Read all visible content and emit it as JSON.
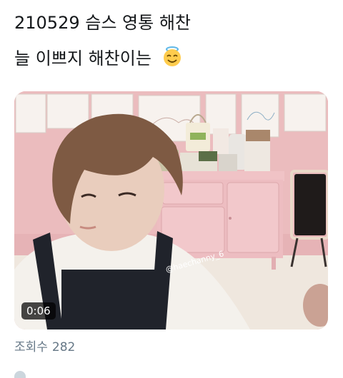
{
  "tweet": {
    "line1": "210529 슴스 영통 해찬",
    "line2": "늘 이쁘지 해찬이는",
    "emoji": "smiling-face-with-halo-icon"
  },
  "video": {
    "timestamp": "0:06",
    "watermark": "@haechanny_6"
  },
  "stats": {
    "views_label": "조회수",
    "views_count": "282"
  },
  "colors": {
    "wall_pink": "#e9b7bb",
    "text_primary": "#14171a",
    "text_secondary": "#657786"
  }
}
